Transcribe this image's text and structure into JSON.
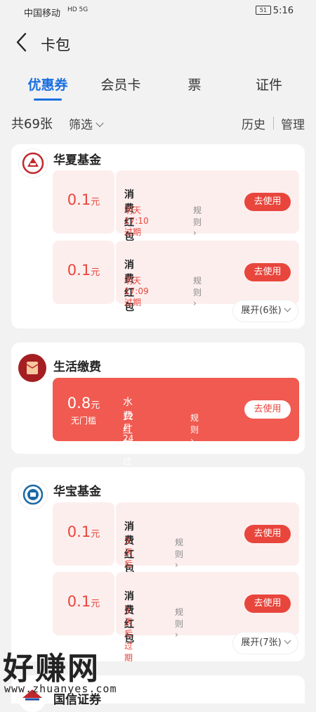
{
  "status": {
    "carrier": "中国移动",
    "indicators": "HD 5G",
    "battery": "51",
    "time": "5:16"
  },
  "header": {
    "title": "卡包"
  },
  "tabs": [
    {
      "label": "优惠券"
    },
    {
      "label": "会员卡"
    },
    {
      "label": "票"
    },
    {
      "label": "证件"
    }
  ],
  "filterbar": {
    "count": "共69张",
    "filter": "筛选",
    "history": "历史",
    "manage": "管理"
  },
  "groups": [
    {
      "name": "华夏基金",
      "coupons": [
        {
          "amount": "0.1",
          "unit": "元",
          "title": "消费红包",
          "expiry": "明天17:10过期",
          "rule": "规则",
          "button": "去使用"
        },
        {
          "amount": "0.1",
          "unit": "元",
          "title": "消费红包",
          "expiry": "明天17:09过期",
          "rule": "规则",
          "button": "去使用"
        }
      ],
      "expand": "展开(6张)"
    },
    {
      "name": "生活缴费",
      "coupons": [
        {
          "amount": "0.8",
          "unit": "元",
          "sub": "无门槛",
          "title": "水费红包",
          "expiry": "12月24日过期",
          "rule": "规则",
          "button": "去使用"
        }
      ]
    },
    {
      "name": "华宝基金",
      "coupons": [
        {
          "amount": "0.1",
          "unit": "元",
          "title": "消费红包",
          "expiry": "3天后过期",
          "rule": "规则",
          "button": "去使用"
        },
        {
          "amount": "0.1",
          "unit": "元",
          "title": "消费红包",
          "expiry": "3天后过期",
          "rule": "规则",
          "button": "去使用"
        }
      ],
      "expand": "展开(7张)"
    },
    {
      "name": "国信证券"
    }
  ],
  "watermark": {
    "text": "好赚网",
    "url": "www.zhuanyes.com"
  },
  "colors": {
    "accent": "#1a6fe0",
    "red": "#e8463c",
    "coupon_bg": "#fdeeee"
  }
}
